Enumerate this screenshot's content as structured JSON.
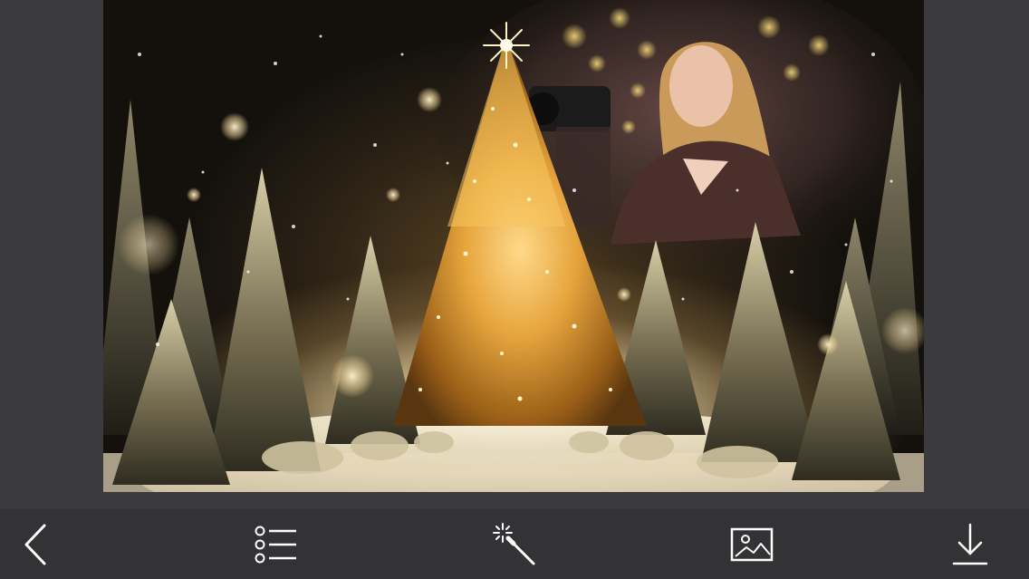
{
  "editor": {
    "photo_name": "christmas-frame-photo"
  },
  "toolbar": {
    "buttons": [
      {
        "name": "back-button",
        "icon": "chevron-left-icon"
      },
      {
        "name": "frames-list-button",
        "icon": "list-icon"
      },
      {
        "name": "effects-button",
        "icon": "magic-wand-icon"
      },
      {
        "name": "gallery-button",
        "icon": "image-icon"
      },
      {
        "name": "download-button",
        "icon": "download-icon"
      }
    ]
  },
  "colors": {
    "toolbar_bg": "#333335",
    "workspace_bg": "#3b3b3d",
    "icon": "#ffffff",
    "glow": "#f2b94a"
  }
}
